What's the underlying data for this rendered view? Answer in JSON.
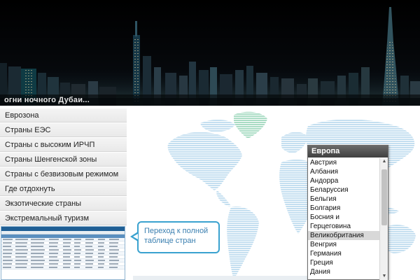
{
  "banner": {
    "caption": "огни ночного Дубаи..."
  },
  "sidebar": {
    "items": [
      {
        "label": "Еврозона"
      },
      {
        "label": "Страны ЕЭС"
      },
      {
        "label": "Страны с высоким ИРЧП"
      },
      {
        "label": "Страны Шенгенской зоны"
      },
      {
        "label": "Страны с безвизовым режимом"
      },
      {
        "label": "Где отдохнуть"
      },
      {
        "label": "Экзотические страны"
      },
      {
        "label": "Экстремальный туризм"
      }
    ]
  },
  "callout": {
    "text": "Переход к полной таблице стран"
  },
  "dropdown": {
    "title": "Европа",
    "selected": "Великобритания",
    "options": [
      "Австрия",
      "Албания",
      "Андорра",
      "Беларуссия",
      "Бельгия",
      "Болгария",
      "Босния и Герцеговина",
      "Великобритания",
      "Венгрия",
      "Германия",
      "Греция",
      "Дания"
    ]
  },
  "colors": {
    "map_land": "#c4dff0",
    "map_highlight": "#a9dcc4",
    "callout_border": "#3aa2cf",
    "callout_text": "#3a7fb0"
  },
  "icons": {
    "scroll_up": "▲",
    "scroll_down": "▼"
  }
}
